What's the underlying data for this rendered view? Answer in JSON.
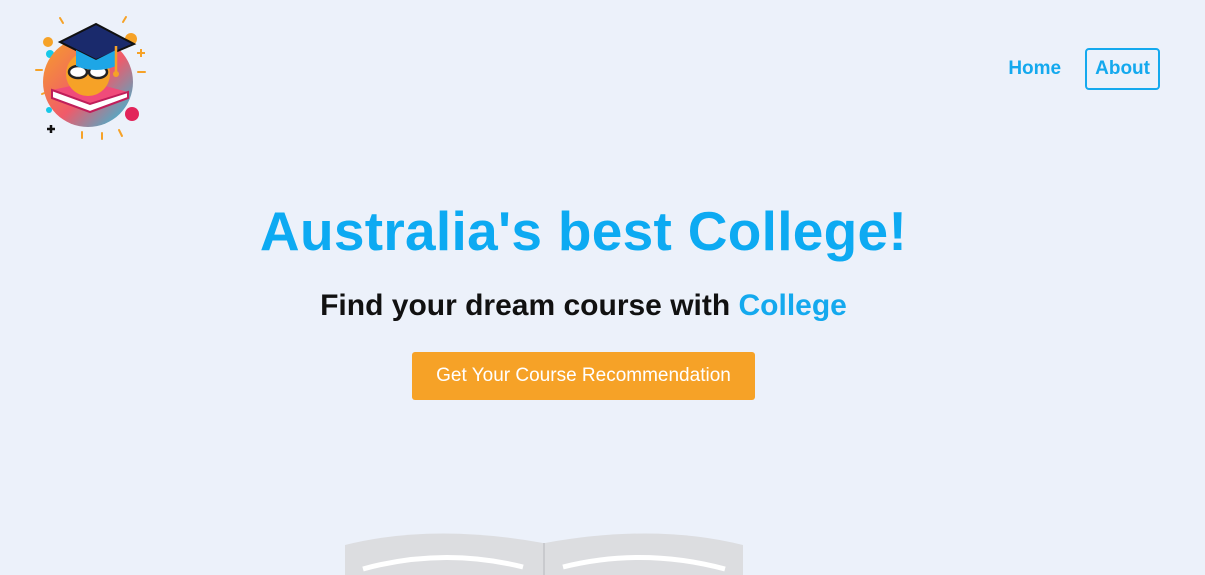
{
  "header": {
    "logo_icon": "graduation-cap-book-icon",
    "nav": [
      {
        "label": "Home"
      },
      {
        "label": "About"
      }
    ]
  },
  "hero": {
    "title": "Australia's best College!",
    "subtitle_prefix": "Find your dream course with ",
    "subtitle_accent": "College",
    "cta_label": "Get Your Course Recommendation"
  },
  "illustration": {
    "icon": "open-book-icon"
  },
  "colors": {
    "background": "#ECF1FA",
    "primary": "#0DAAF2",
    "cta": "#F6A227"
  }
}
